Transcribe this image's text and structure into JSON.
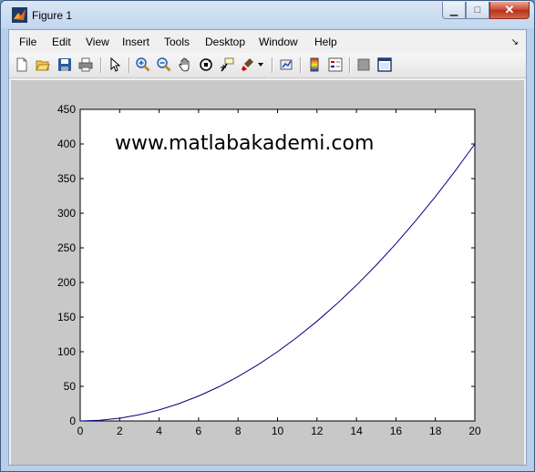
{
  "window": {
    "title": "Figure 1"
  },
  "menu": [
    "File",
    "Edit",
    "View",
    "Insert",
    "Tools",
    "Desktop",
    "Window",
    "Help"
  ],
  "toolbar_icons": [
    "new-figure-icon",
    "open-file-icon",
    "save-figure-icon",
    "print-figure-icon",
    "edit-plot-icon",
    "zoom-in-icon",
    "zoom-out-icon",
    "pan-icon",
    "rotate-3d-icon",
    "data-cursor-icon",
    "brush-icon",
    "link-plot-icon",
    "insert-colorbar-icon",
    "insert-legend-icon",
    "hide-plot-tools-icon",
    "show-plot-tools-icon"
  ],
  "annotation": "www.matlabakademi.com",
  "colors": {
    "line": "#00007f",
    "figure_bg": "#c8c8c8"
  },
  "chart_data": {
    "type": "line",
    "x": [
      0,
      1,
      2,
      3,
      4,
      5,
      6,
      7,
      8,
      9,
      10,
      11,
      12,
      13,
      14,
      15,
      16,
      17,
      18,
      19,
      20
    ],
    "series": [
      {
        "values": [
          0,
          1,
          4,
          9,
          16,
          25,
          36,
          49,
          64,
          81,
          100,
          121,
          144,
          169,
          196,
          225,
          256,
          289,
          324,
          361,
          400
        ]
      }
    ],
    "xlim": [
      0,
      20
    ],
    "ylim": [
      0,
      450
    ],
    "xticks": [
      0,
      2,
      4,
      6,
      8,
      10,
      12,
      14,
      16,
      18,
      20
    ],
    "yticks": [
      0,
      50,
      100,
      150,
      200,
      250,
      300,
      350,
      400,
      450
    ],
    "grid": false,
    "title": "",
    "xlabel": "",
    "ylabel": ""
  }
}
